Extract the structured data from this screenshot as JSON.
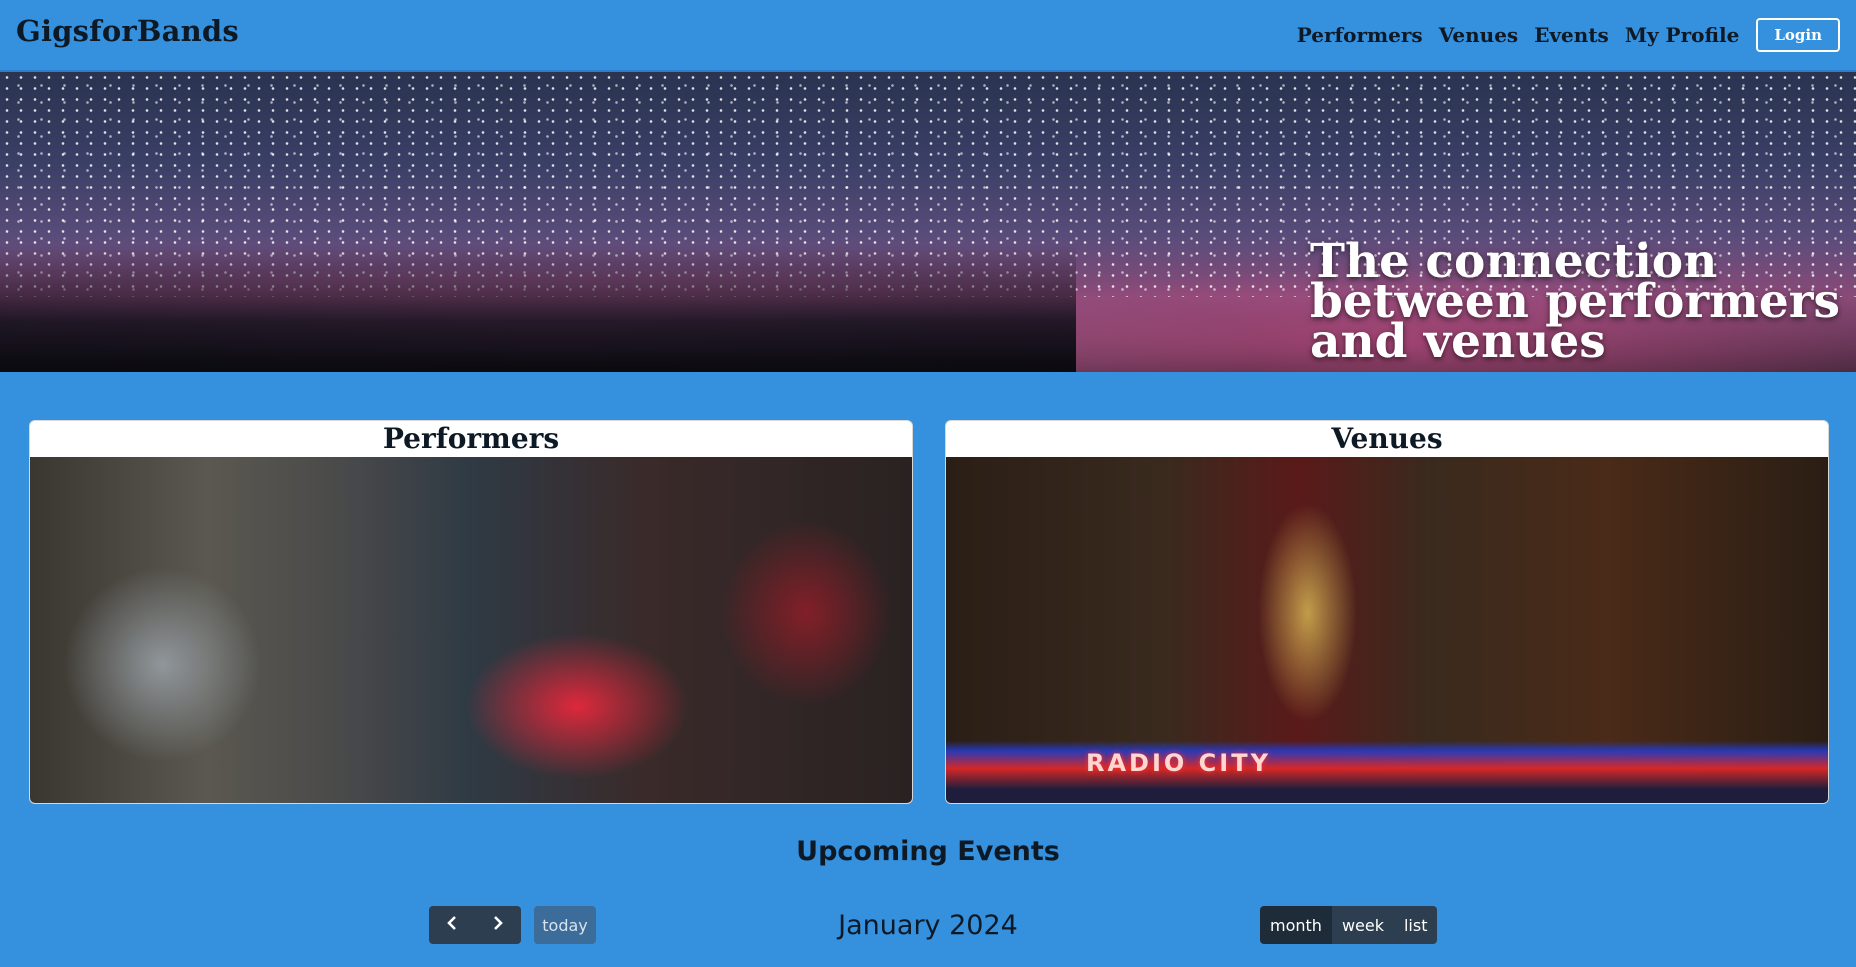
{
  "navbar": {
    "brand": "GigsforBands",
    "links": [
      "Performers",
      "Venues",
      "Events",
      "My Profile"
    ],
    "login_label": "Login"
  },
  "hero": {
    "tagline": "The connection between performers and venues"
  },
  "cards": {
    "performers_title": "Performers",
    "venues_title": "Venues",
    "venue_sign_text": "RADIO CITY"
  },
  "events": {
    "title": "Upcoming Events",
    "prev_icon": "chevron-left-icon",
    "next_icon": "chevron-right-icon",
    "today_label": "today",
    "calendar_title": "January 2024",
    "views": [
      "month",
      "week",
      "list"
    ],
    "active_view": "month"
  }
}
